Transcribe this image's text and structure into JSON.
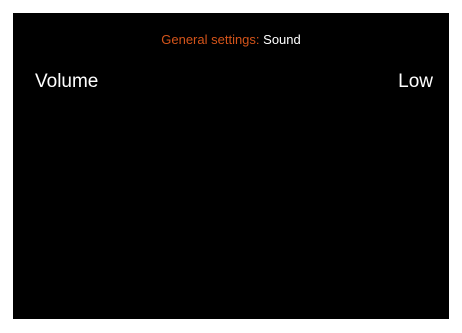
{
  "header": {
    "section_label": "General settings:",
    "page_label": "Sound"
  },
  "settings": {
    "volume": {
      "label": "Volume",
      "value": "Low"
    }
  },
  "colors": {
    "background": "#000000",
    "accent": "#d4541a",
    "text": "#ffffff"
  }
}
